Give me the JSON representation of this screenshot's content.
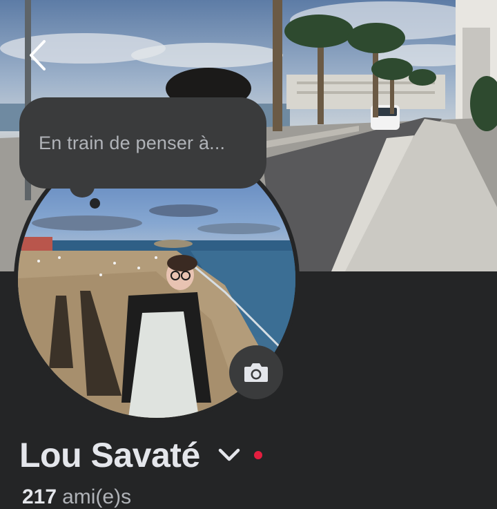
{
  "cover": {
    "description_icon": "cover-photo"
  },
  "navigation": {
    "back_icon": "chevron-left-icon"
  },
  "status_bubble": {
    "placeholder": "En train de penser à..."
  },
  "profile": {
    "name": "Lou Savaté",
    "switch_icon": "chevron-down-icon",
    "notification_dot_color": "#e41e3f",
    "camera_icon": "camera-icon"
  },
  "friends": {
    "count": "217",
    "label": "ami(e)s"
  },
  "colors": {
    "background": "#242526",
    "surface": "#3a3b3c",
    "text_primary": "#e4e6eb",
    "text_secondary": "#b0b3b8"
  }
}
